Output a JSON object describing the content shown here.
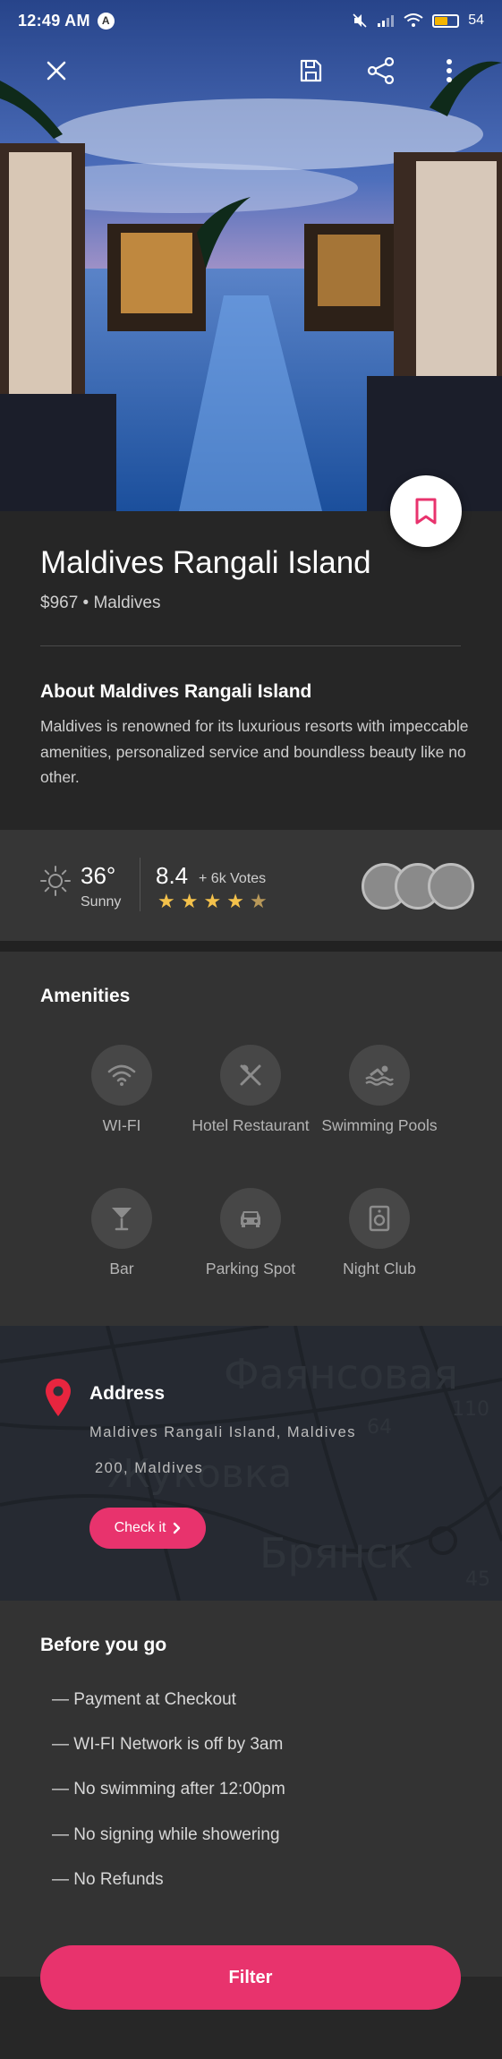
{
  "status_bar": {
    "time": "12:49 AM",
    "app_badge": "A",
    "battery": "54"
  },
  "toolbar": {
    "close_icon": "close-icon",
    "save_icon": "save-icon",
    "share_icon": "share-icon",
    "more_icon": "more-vert-icon"
  },
  "hero": {
    "bookmark_icon": "bookmark-icon"
  },
  "place": {
    "title": "Maldives Rangali Island",
    "subtitle": "$967 • Maldives",
    "about_heading": "About Maldives Rangali Island",
    "about_text": "Maldives is renowned for its luxurious resorts with impeccable amenities, personalized service and boundless beauty like no other."
  },
  "weather": {
    "temperature": "36°",
    "condition": "Sunny"
  },
  "rating": {
    "score": "8.4",
    "votes": "+ 6k Votes",
    "stars": 4.5
  },
  "amenities": {
    "heading": "Amenities",
    "items": [
      {
        "label": "WI-FI",
        "icon": "wifi-icon"
      },
      {
        "label": "Hotel Restaurant",
        "icon": "restaurant-icon"
      },
      {
        "label": "Swimming Pools",
        "icon": "pool-icon"
      },
      {
        "label": "Bar",
        "icon": "cocktail-icon"
      },
      {
        "label": "Parking Spot",
        "icon": "car-icon"
      },
      {
        "label": "Night Club",
        "icon": "speaker-icon"
      }
    ]
  },
  "address": {
    "heading": "Address",
    "line1": "Maldives Rangali Island, Maldives",
    "line2": "200, Maldives",
    "button": "Check it",
    "map_labels": [
      "Фаянсовая",
      "Жуковка",
      "Брянск",
      "64",
      "110",
      "45"
    ]
  },
  "before_you_go": {
    "heading": "Before you go",
    "rules": [
      "— Payment at Checkout",
      "— WI-FI Network is off by 3am",
      "— No swimming after 12:00pm",
      "— No signing while showering",
      "— No Refunds"
    ]
  },
  "filter_button": "Filter",
  "colors": {
    "accent": "#e8336d",
    "background": "#2a2a2a",
    "star": "#f3c14b"
  }
}
